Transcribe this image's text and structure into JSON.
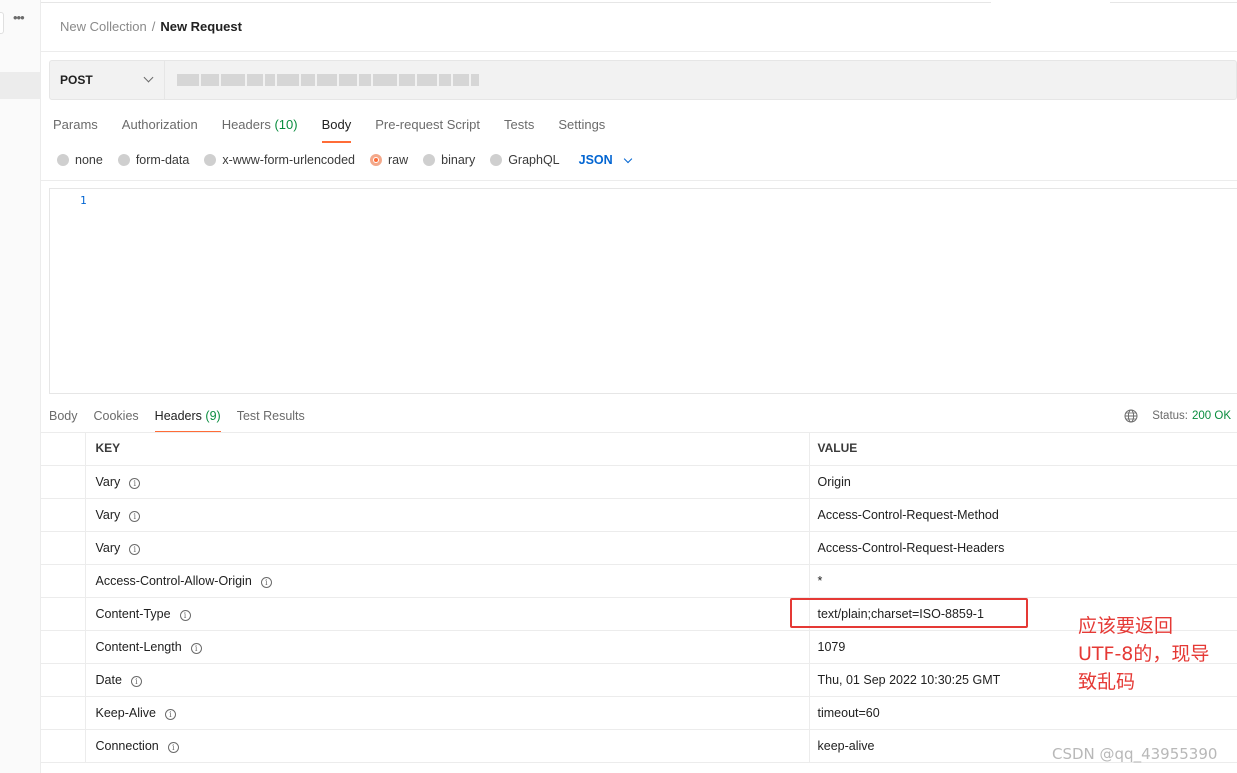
{
  "sidebar": {
    "more_label": "•••"
  },
  "breadcrumb": {
    "collection": "New Collection",
    "separator": "/",
    "request": "New Request"
  },
  "request": {
    "method": "POST",
    "tabs": [
      {
        "label": "Params"
      },
      {
        "label": "Authorization"
      },
      {
        "label": "Headers",
        "count": "(10)"
      },
      {
        "label": "Body"
      },
      {
        "label": "Pre-request Script"
      },
      {
        "label": "Tests"
      },
      {
        "label": "Settings"
      }
    ],
    "active_tab": "Body",
    "body_types": [
      "none",
      "form-data",
      "x-www-form-urlencoded",
      "raw",
      "binary",
      "GraphQL"
    ],
    "selected_body_type": "raw",
    "raw_format": "JSON",
    "editor": {
      "line_number": "1"
    }
  },
  "response": {
    "tabs": [
      {
        "label": "Body"
      },
      {
        "label": "Cookies"
      },
      {
        "label": "Headers",
        "count": "(9)"
      },
      {
        "label": "Test Results"
      }
    ],
    "active_tab": "Headers",
    "status_label": "Status:",
    "status_value": "200 OK",
    "columns": {
      "key": "KEY",
      "value": "VALUE"
    },
    "headers": [
      {
        "key": "Vary",
        "value": "Origin"
      },
      {
        "key": "Vary",
        "value": "Access-Control-Request-Method"
      },
      {
        "key": "Vary",
        "value": "Access-Control-Request-Headers"
      },
      {
        "key": "Access-Control-Allow-Origin",
        "value": "*"
      },
      {
        "key": "Content-Type",
        "value": "text/plain;charset=ISO-8859-1"
      },
      {
        "key": "Content-Length",
        "value": "1079"
      },
      {
        "key": "Date",
        "value": "Thu, 01 Sep 2022 10:30:25 GMT"
      },
      {
        "key": "Keep-Alive",
        "value": "timeout=60"
      },
      {
        "key": "Connection",
        "value": "keep-alive"
      }
    ]
  },
  "annotation": {
    "text_lines": [
      "应该要返回",
      "UTF-8的，现导",
      "致乱码"
    ],
    "color": "#e53935"
  },
  "watermark": "CSDN @qq_43955390",
  "colors": {
    "accent": "#ff6c37",
    "link": "#0265d2",
    "success": "#0a8d3f"
  }
}
